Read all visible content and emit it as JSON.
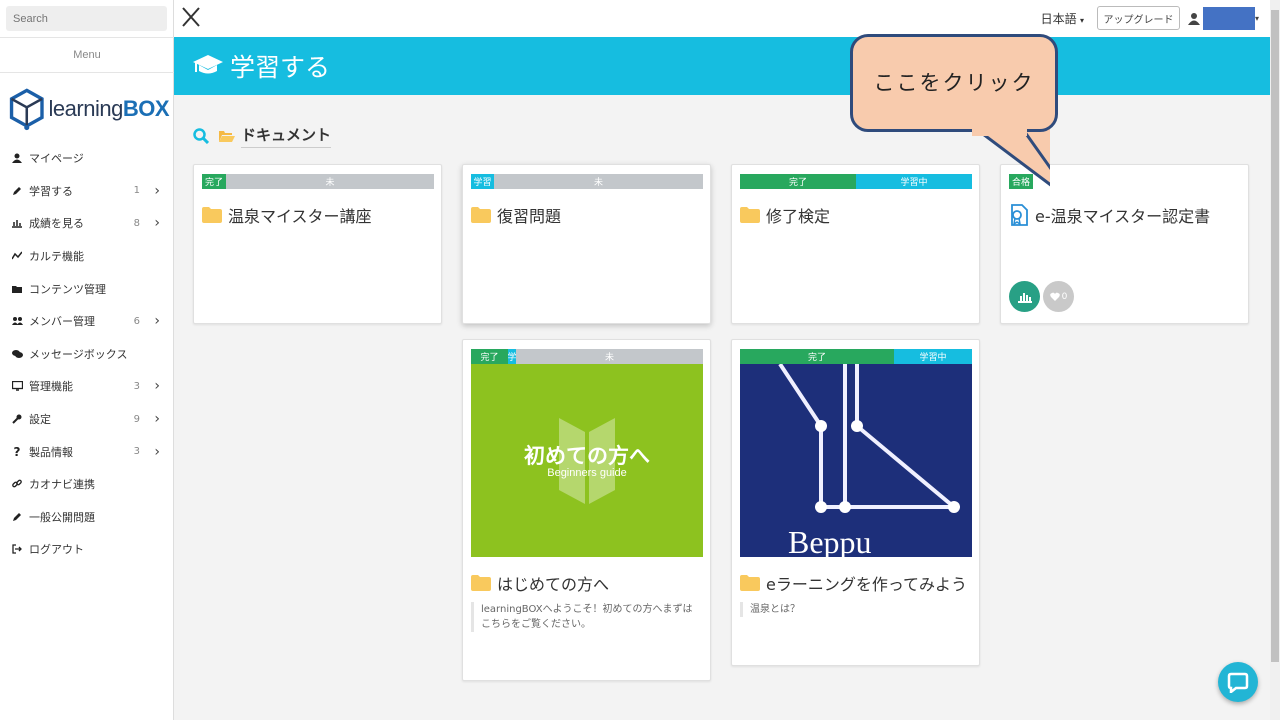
{
  "search": {
    "placeholder": "Search"
  },
  "sidebar": {
    "menu_label": "Menu",
    "logo_text_a": "learning",
    "logo_text_b": "BOX",
    "items": [
      {
        "label": "マイページ",
        "count": "",
        "icon": "user-icon"
      },
      {
        "label": "学習する",
        "count": "1",
        "icon": "pencil-icon"
      },
      {
        "label": "成績を見る",
        "count": "8",
        "icon": "bar-chart-icon"
      },
      {
        "label": "カルテ機能",
        "count": "",
        "icon": "line-chart-icon"
      },
      {
        "label": "コンテンツ管理",
        "count": "",
        "icon": "folder-icon"
      },
      {
        "label": "メンバー管理",
        "count": "6",
        "icon": "users-icon"
      },
      {
        "label": "メッセージボックス",
        "count": "",
        "icon": "comments-icon"
      },
      {
        "label": "管理機能",
        "count": "3",
        "icon": "monitor-icon"
      },
      {
        "label": "設定",
        "count": "9",
        "icon": "wrench-icon"
      },
      {
        "label": "製品情報",
        "count": "3",
        "icon": "question-icon"
      },
      {
        "label": "カオナビ連携",
        "count": "",
        "icon": "link-icon"
      },
      {
        "label": "一般公開問題",
        "count": "",
        "icon": "pencil-icon"
      },
      {
        "label": "ログアウト",
        "count": "",
        "icon": "logout-icon"
      }
    ]
  },
  "topbar": {
    "language": "日本語",
    "upgrade": "アップグレード"
  },
  "header": {
    "title": "学習する"
  },
  "breadcrumb": {
    "label": "ドキュメント"
  },
  "cards": {
    "c1": {
      "title": "温泉マイスター講座",
      "bar": [
        "完了",
        "未"
      ]
    },
    "c2": {
      "title": "復習問題",
      "bar": [
        "学習",
        "未"
      ]
    },
    "c3": {
      "title": "修了検定",
      "bar": [
        "完了",
        "学習中"
      ]
    },
    "c4": {
      "title": "e-温泉マイスター認定書",
      "badge": "合格",
      "likes": "0"
    },
    "c5": {
      "title": "はじめての方へ",
      "bar": [
        "完了",
        "学",
        "未"
      ],
      "thumb_title": "初めての方へ",
      "thumb_sub": "Beginners guide",
      "desc": "learningBOXへようこそ！初めての方へまずはこちらをご覧ください。"
    },
    "c6": {
      "title": "eラーニングを作ってみよう",
      "bar": [
        "完了",
        "学習中"
      ],
      "thumb_text": "Beppu",
      "desc": "温泉とは？"
    }
  },
  "callout": {
    "text": "ここをクリック"
  },
  "colors": {
    "accent": "#16bde0",
    "done": "#28a85e",
    "pending": "#c3c7cb",
    "callout_fill": "#f8cbad",
    "callout_border": "#2f4b7c"
  }
}
